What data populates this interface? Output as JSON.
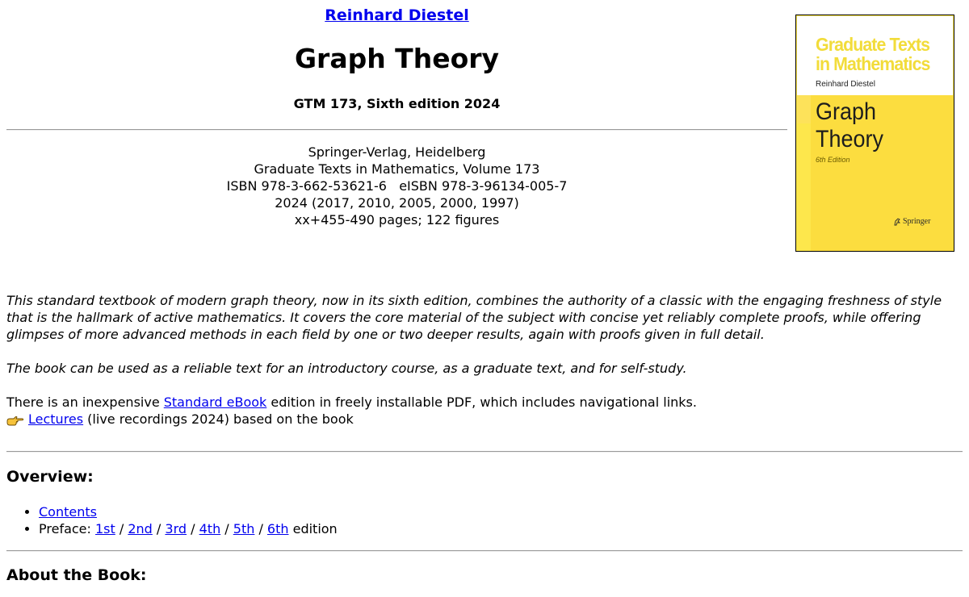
{
  "header": {
    "author": "Reinhard Diestel",
    "title": "Graph Theory",
    "edition": "GTM 173, Sixth edition 2024"
  },
  "pubinfo": {
    "publisher": "Springer-Verlag, Heidelberg",
    "series": "Graduate Texts in Mathematics, Volume 173",
    "isbn": "ISBN 978-3-662-53621-6   eISBN 978-3-96134-005-7",
    "years": "2024 (2017, 2010, 2005, 2000, 1997)",
    "pages": "xx+455-490 pages; 122 figures"
  },
  "cover": {
    "series_line1": "Graduate Texts",
    "series_line2": "in Mathematics",
    "author": "Reinhard Diestel",
    "title_line1": "Graph",
    "title_line2": "Theory",
    "edition": "6th Edition",
    "publisher": "Springer",
    "colors": {
      "yellow": "#fcdd3f",
      "series_text": "#f2dc3a"
    }
  },
  "intro": {
    "blurb1": "This standard textbook of modern graph theory, now in its sixth edition, combines the authority of a classic with the engaging freshness of style that is the hallmark of active mathematics. It covers the core material of the subject with concise yet reliably complete proofs, while offering glimpses of more advanced methods in each field by one or two deeper results, again with proofs given in full detail.",
    "blurb2": "The book can be used as a reliable text for an introductory course, as a graduate text, and for self-study.",
    "ebook_prefix": "There is an inexpensive ",
    "ebook_link": "Standard eBook",
    "ebook_suffix": " edition in freely installable PDF, which includes navigational links.",
    "lectures_link": "Lectures",
    "lectures_suffix": " (live recordings 2024) based on the book",
    "lectures_icon": "pointing-hand-icon"
  },
  "overview": {
    "heading": "Overview:",
    "contents_link": "Contents",
    "preface_label": "Preface: ",
    "preface_links": [
      "1st",
      "2nd",
      "3rd",
      "4th",
      "5th",
      "6th"
    ],
    "separator": " / ",
    "preface_suffix": " edition"
  },
  "about": {
    "heading": "About the Book:"
  },
  "colors": {
    "link": "#0000ee",
    "rule": "#9a9a9a"
  }
}
